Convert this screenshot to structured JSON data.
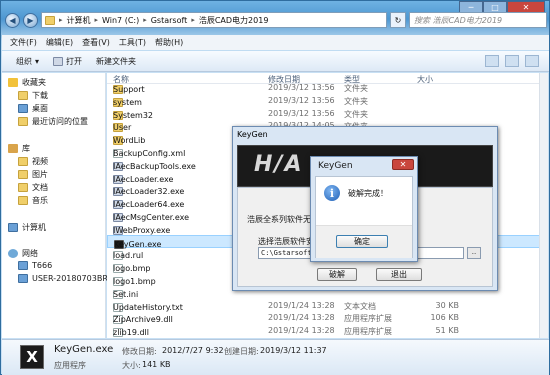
{
  "window": {
    "address": [
      "计算机",
      "Win7 (C:)",
      "Gstarsoft",
      "浩辰CAD电力2019"
    ],
    "search_placeholder": "搜索 浩辰CAD电力2019"
  },
  "menu": [
    "文件(F)",
    "编辑(E)",
    "查看(V)",
    "工具(T)",
    "帮助(H)"
  ],
  "toolbar": {
    "organize": "组织",
    "open": "打开",
    "new_folder": "新建文件夹"
  },
  "nav": {
    "favorites": "收藏夹",
    "downloads": "下载",
    "desktop": "桌面",
    "recent": "最近访问的位置",
    "libraries": "库",
    "videos": "视频",
    "pictures": "图片",
    "documents": "文档",
    "music": "音乐",
    "computer": "计算机",
    "network": "网络",
    "host1": "T666",
    "host2": "USER-20180703BR"
  },
  "columns": {
    "name": "名称",
    "date": "修改日期",
    "type": "类型",
    "size": "大小"
  },
  "files": [
    {
      "name": "Support",
      "date": "2019/3/12 13:56",
      "type": "文件夹",
      "size": "",
      "icon": "folder-icon"
    },
    {
      "name": "system",
      "date": "2019/3/12 13:56",
      "type": "文件夹",
      "size": "",
      "icon": "folder-icon"
    },
    {
      "name": "System32",
      "date": "2019/3/12 13:56",
      "type": "文件夹",
      "size": "",
      "icon": "folder-icon"
    },
    {
      "name": "User",
      "date": "2019/3/12 14:05",
      "type": "文件夹",
      "size": "",
      "icon": "folder-icon"
    },
    {
      "name": "WordLib",
      "date": "",
      "type": "",
      "size": "",
      "icon": "folder-icon"
    },
    {
      "name": "BackupConfig.xml",
      "date": "",
      "type": "",
      "size": "",
      "icon": "file-icon"
    },
    {
      "name": "IAecBackupTools.exe",
      "date": "",
      "type": "",
      "size": "",
      "icon": "exe-icon"
    },
    {
      "name": "IAecLoader.exe",
      "date": "",
      "type": "",
      "size": "",
      "icon": "exe-icon"
    },
    {
      "name": "IAecLoader32.exe",
      "date": "",
      "type": "",
      "size": "",
      "icon": "exe-icon"
    },
    {
      "name": "IAecLoader64.exe",
      "date": "",
      "type": "",
      "size": "",
      "icon": "exe-icon"
    },
    {
      "name": "IAecMsgCenter.exe",
      "date": "",
      "type": "",
      "size": "",
      "icon": "exe-icon"
    },
    {
      "name": "IWebProxy.exe",
      "date": "",
      "type": "",
      "size": "",
      "icon": "exe-icon"
    },
    {
      "name": "KeyGen.exe",
      "date": "",
      "type": "",
      "size": "",
      "icon": "keygen-icon"
    },
    {
      "name": "load.rul",
      "date": "",
      "type": "",
      "size": "",
      "icon": "file-icon"
    },
    {
      "name": "logo.bmp",
      "date": "",
      "type": "",
      "size": "",
      "icon": "file-icon"
    },
    {
      "name": "logo1.bmp",
      "date": "",
      "type": "",
      "size": "",
      "icon": "file-icon"
    },
    {
      "name": "Set.ini",
      "date": "",
      "type": "",
      "size": "",
      "icon": "file-icon"
    },
    {
      "name": "UpdateHistory.txt",
      "date": "2019/1/24 13:28",
      "type": "文本文档",
      "size": "30 KB",
      "icon": "file-icon"
    },
    {
      "name": "ZipArchive9.dll",
      "date": "2019/1/24 13:28",
      "type": "应用程序扩展",
      "size": "106 KB",
      "icon": "file-icon"
    },
    {
      "name": "zlib19.dll",
      "date": "2019/1/24 13:28",
      "type": "应用程序扩展",
      "size": "51 KB",
      "icon": "file-icon"
    }
  ],
  "details": {
    "name": "KeyGen.exe",
    "modified_label": "修改日期:",
    "modified": "2012/7/27 9:32",
    "created_label": "创建日期:",
    "created": "2019/3/12 11:37",
    "type": "应用程序",
    "size_label": "大小:",
    "size": "141 KB"
  },
  "keygen": {
    "title": "KeyGen",
    "label1": "浩辰全系列软件无限",
    "label2": "选择浩辰软件安装",
    "path": "C:\\Gstarsoft\\浩",
    "browse": "..",
    "crack": "破解",
    "exit": "退出"
  },
  "msgbox": {
    "title": "KeyGen",
    "close": "✕",
    "message": "破解完成！",
    "ok": "确定"
  }
}
